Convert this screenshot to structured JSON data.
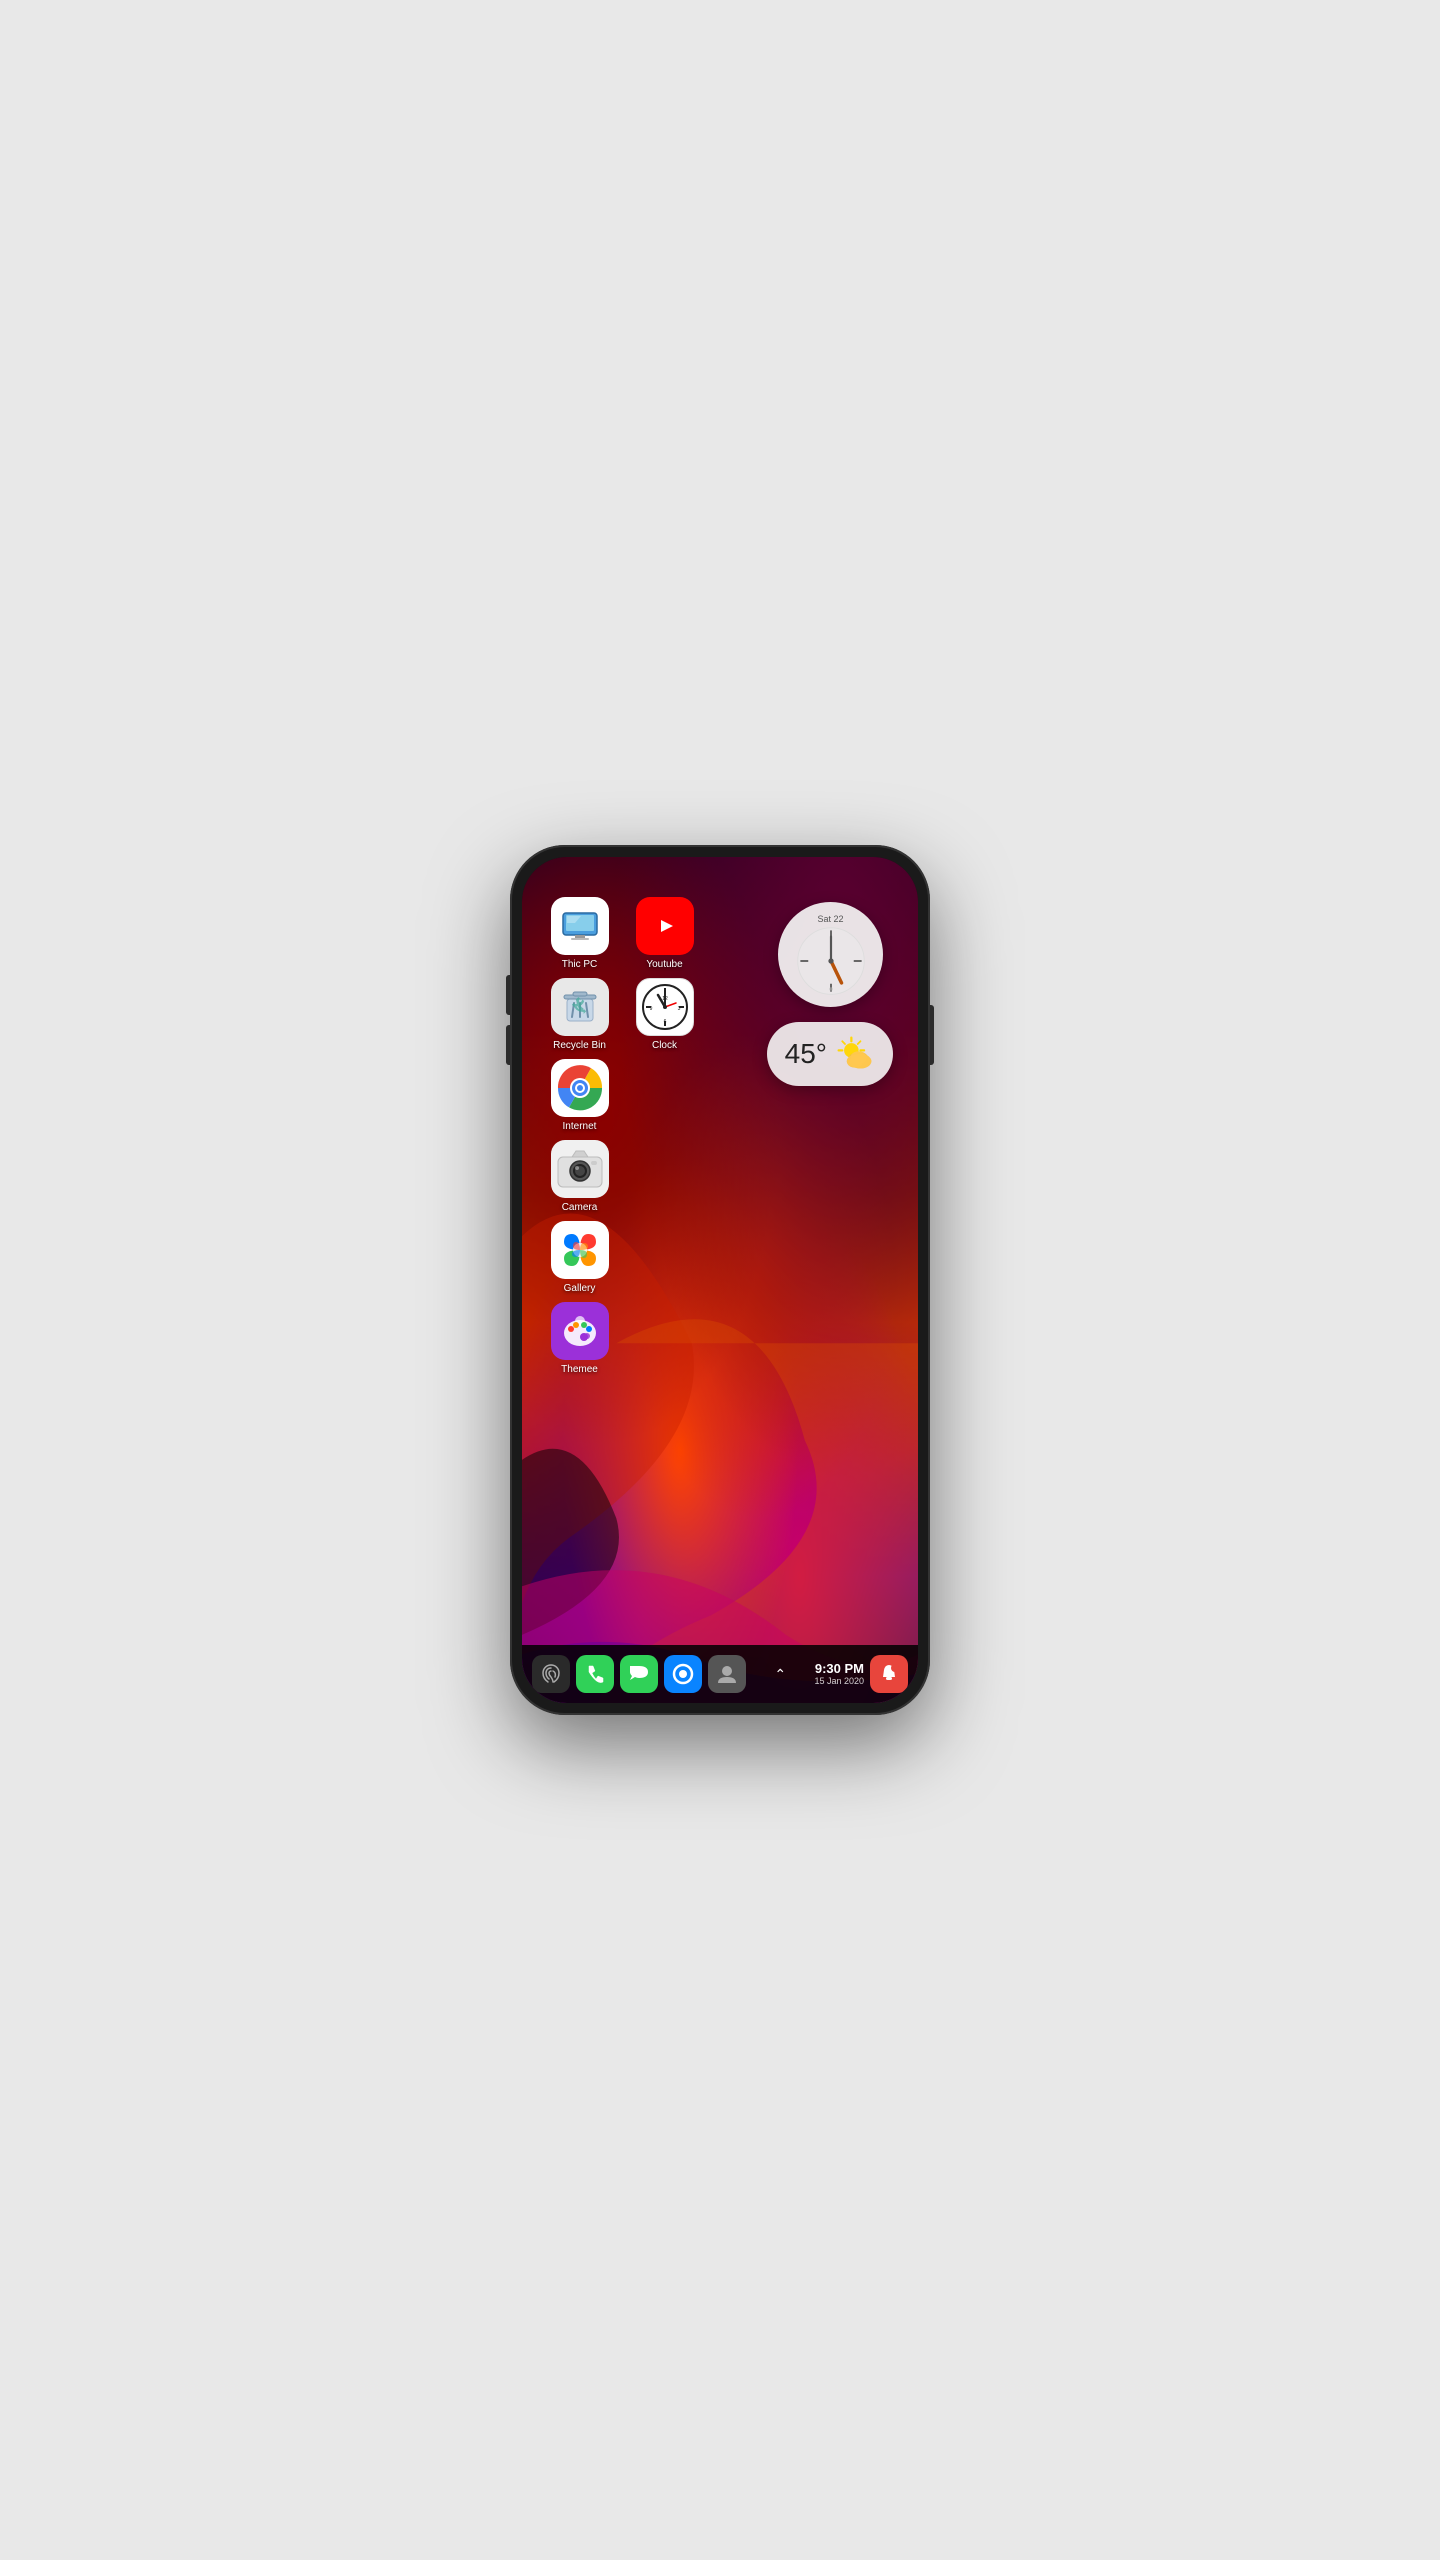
{
  "phone": {
    "status_bar": {
      "time": "9:30 PM",
      "date": "15 Jan  2020"
    },
    "clock_widget": {
      "date_label": "Sat 22",
      "hour_angle": 180,
      "minute_angle": 0
    },
    "weather_widget": {
      "temperature": "45°",
      "condition": "partly cloudy"
    },
    "apps": [
      {
        "row": 1,
        "items": [
          {
            "id": "thicpc",
            "label": "Thic PC",
            "icon_type": "thicpc"
          },
          {
            "id": "youtube",
            "label": "Youtube",
            "icon_type": "youtube"
          }
        ]
      },
      {
        "row": 2,
        "items": [
          {
            "id": "recycle",
            "label": "Recycle Bin",
            "icon_type": "recycle"
          },
          {
            "id": "clock",
            "label": "Clock",
            "icon_type": "clock"
          }
        ]
      },
      {
        "row": 3,
        "items": [
          {
            "id": "internet",
            "label": "Internet",
            "icon_type": "chrome"
          }
        ]
      },
      {
        "row": 4,
        "items": [
          {
            "id": "camera",
            "label": "Camera",
            "icon_type": "camera"
          }
        ]
      },
      {
        "row": 5,
        "items": [
          {
            "id": "gallery",
            "label": "Gallery",
            "icon_type": "gallery"
          }
        ]
      },
      {
        "row": 6,
        "items": [
          {
            "id": "themee",
            "label": "Themee",
            "icon_type": "themee"
          }
        ]
      }
    ],
    "dock": [
      {
        "id": "fingerprint",
        "type": "fingerprint"
      },
      {
        "id": "phone",
        "type": "phone"
      },
      {
        "id": "messages",
        "type": "messages"
      },
      {
        "id": "circle",
        "type": "circle"
      },
      {
        "id": "contacts",
        "type": "contacts"
      },
      {
        "id": "chevron",
        "type": "chevron"
      },
      {
        "id": "time-dock",
        "type": "time"
      },
      {
        "id": "notify",
        "type": "notify"
      }
    ]
  }
}
